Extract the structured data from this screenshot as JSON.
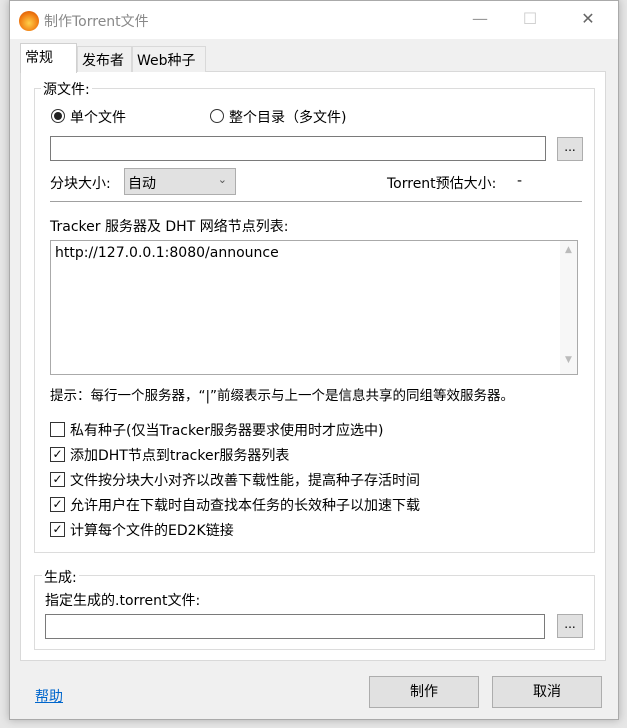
{
  "window": {
    "title": "制作Torrent文件",
    "minimize": "—",
    "maximize": "☐",
    "close": "✕"
  },
  "tabs": [
    {
      "label": "常规"
    },
    {
      "label": "发布者"
    },
    {
      "label": "Web种子"
    }
  ],
  "source": {
    "group_label": "源文件:",
    "radio_single": "单个文件",
    "radio_dir": "整个目录（多文件)",
    "path_value": "",
    "browse": "...",
    "block_size_label": "分块大小:",
    "block_size_value": "自动",
    "estimate_label": "Torrent预估大小:",
    "estimate_value": "-",
    "tracker_label": "Tracker 服务器及 DHT 网络节点列表:",
    "tracker_value": "http://127.0.0.1:8080/announce",
    "hint": "提示：每行一个服务器，“|”前缀表示与上一个是信息共享的同组等效服务器。",
    "options": [
      {
        "label": "私有种子(仅当Tracker服务器要求使用时才应选中)",
        "checked": false
      },
      {
        "label": "添加DHT节点到tracker服务器列表",
        "checked": true
      },
      {
        "label": "文件按分块大小对齐以改善下载性能，提高种子存活时间",
        "checked": true
      },
      {
        "label": "允许用户在下载时自动查找本任务的长效种子以加速下载",
        "checked": true
      },
      {
        "label": "计算每个文件的ED2K链接",
        "checked": true
      }
    ]
  },
  "output": {
    "group_label": "生成:",
    "file_label": "指定生成的.torrent文件:",
    "path_value": "",
    "browse": "..."
  },
  "footer": {
    "help": "帮助",
    "create": "制作",
    "cancel": "取消"
  }
}
